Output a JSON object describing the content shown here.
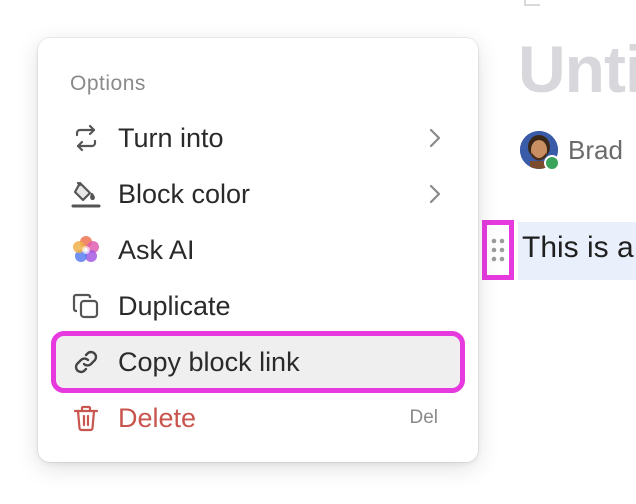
{
  "document": {
    "title": "Unti",
    "author_name": "Brad",
    "block_text": "This is a"
  },
  "menu": {
    "header": "Options",
    "items": [
      {
        "label": "Turn into",
        "icon": "arrows-swap-icon",
        "has_submenu": true
      },
      {
        "label": "Block color",
        "icon": "paint-bucket-icon",
        "has_submenu": true
      },
      {
        "label": "Ask AI",
        "icon": "ai-sparkle-icon",
        "has_submenu": false
      },
      {
        "label": "Duplicate",
        "icon": "duplicate-icon",
        "has_submenu": false
      },
      {
        "label": "Copy block link",
        "icon": "link-icon",
        "has_submenu": false,
        "highlighted": true
      },
      {
        "label": "Delete",
        "icon": "trash-icon",
        "shortcut": "Del",
        "danger": true
      }
    ]
  },
  "colors": {
    "highlight_outline": "#e63adf",
    "danger": "#c9554f",
    "block_background": "#e9f0fb",
    "presence": "#3aa35a"
  }
}
